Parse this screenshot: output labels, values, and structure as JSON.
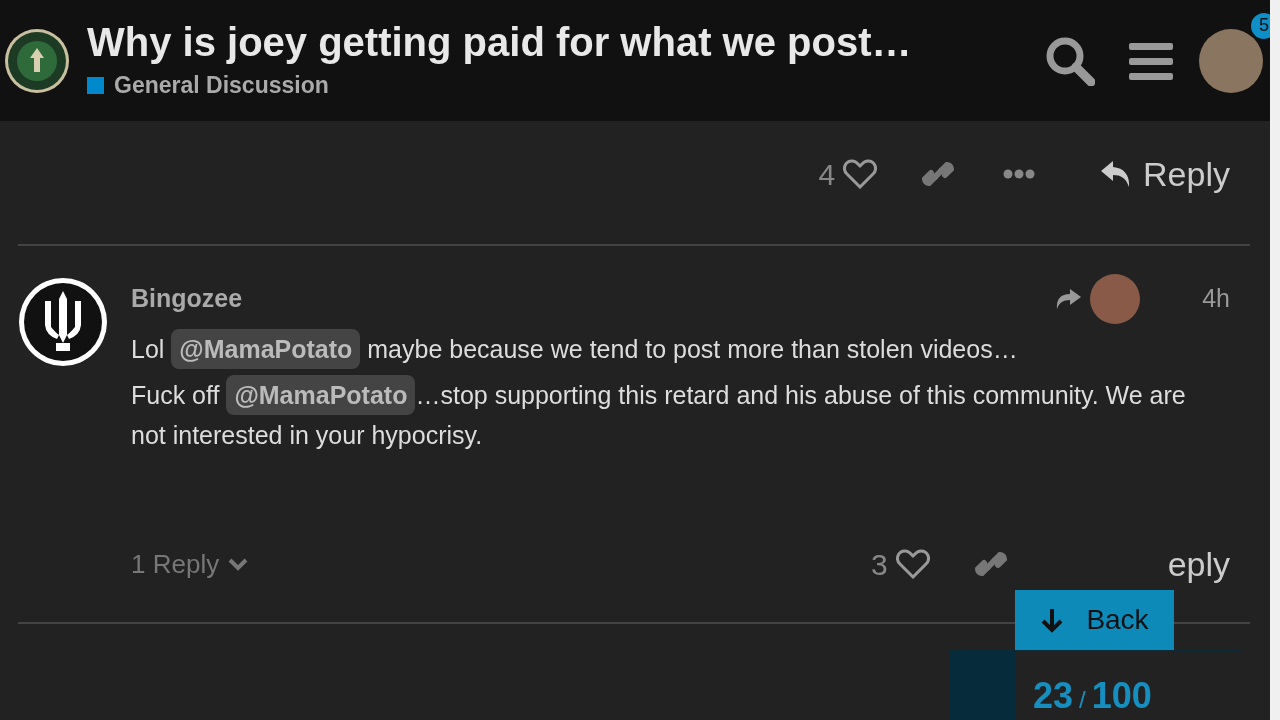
{
  "header": {
    "title": "Why is joey getting paid for what we post…",
    "category": {
      "name": "General Discussion",
      "color": "#0088cc"
    },
    "notification_count": "5"
  },
  "posts": [
    {
      "kind": "actions",
      "like_count": "4",
      "reply_label": "Reply"
    },
    {
      "kind": "post",
      "username": "Bingozee",
      "time": "4h",
      "paragraphs": [
        [
          {
            "kind": "text",
            "text": "Lol "
          },
          {
            "kind": "mention",
            "text": "@MamaPotato"
          },
          {
            "kind": "text",
            "text": " maybe because we tend to post more than stolen videos…"
          }
        ],
        [
          {
            "kind": "text",
            "text": "Fuck off "
          },
          {
            "kind": "mention",
            "text": "@MamaPotato"
          },
          {
            "kind": "text",
            "text": "…stop supporting this retard and his abuse of this community. We are not interested in your hypocrisy."
          }
        ]
      ],
      "replies_label": "1 Reply",
      "like_count": "3",
      "reply_label": "eply"
    }
  ],
  "timeline": {
    "back_label": "Back",
    "current": "23",
    "separator": "/",
    "total": "100"
  }
}
